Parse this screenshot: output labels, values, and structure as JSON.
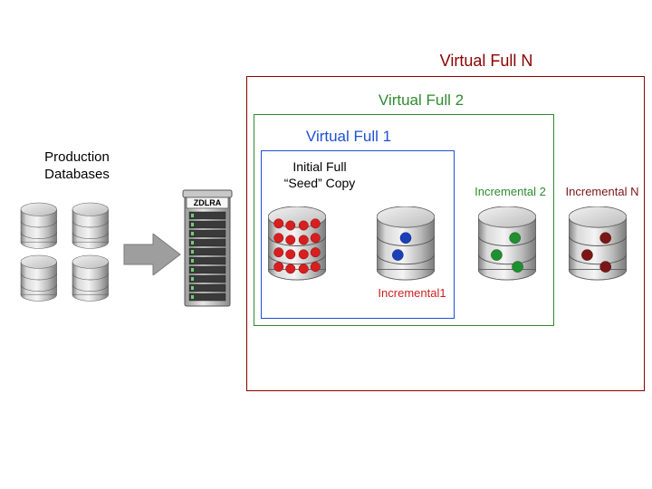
{
  "prod_label": "Production\nDatabases",
  "appliance_label": "ZDLRA",
  "vf_n_title": "Virtual Full N",
  "vf_2_title": "Virtual Full 2",
  "vf_1_title": "Virtual Full 1",
  "seed_label": "Initial Full\n“Seed” Copy",
  "inc1_label": "Incremental1",
  "inc2_label": "Incremental 2",
  "incN_label": "Incremental N",
  "colors": {
    "seed_dot": "#d81e1e",
    "inc1_dot": "#1b3fb8",
    "inc2_dot": "#1f8f2f",
    "incN_dot": "#7a1616"
  }
}
